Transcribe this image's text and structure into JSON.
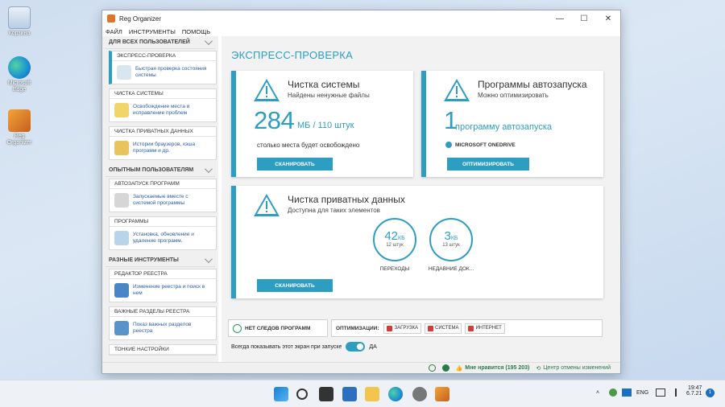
{
  "desktop": {
    "recycle_label": "Корзина",
    "edge_label": "Microsoft Edge",
    "reg_label": "Reg Organizer"
  },
  "window": {
    "title": "Reg Organizer",
    "min": "—",
    "max": "☐",
    "close": "✕"
  },
  "menu": [
    "ФАЙЛ",
    "ИНСТРУМЕНТЫ",
    "ПОМОЩЬ"
  ],
  "sidebar": {
    "sec1": "ДЛЯ ВСЕХ ПОЛЬЗОВАТЕЛЕЙ",
    "sec2": "ОПЫТНЫМ ПОЛЬЗОВАТЕЛЯМ",
    "sec3": "РАЗНЫЕ ИНСТРУМЕНТЫ",
    "items": [
      {
        "head": "ЭКСПРЕСС-ПРОВЕРКА",
        "text": "Быстрая проверка состояния системы"
      },
      {
        "head": "ЧИСТКА СИСТЕМЫ",
        "text": "Освобождение места и исправление проблем"
      },
      {
        "head": "ЧИСТКА ПРИВАТНЫХ ДАННЫХ",
        "text": "Истории браузеров, кэша программ и др."
      },
      {
        "head": "АВТОЗАПУСК ПРОГРАММ",
        "text": "Запускаемые вместе с системой программы"
      },
      {
        "head": "ПРОГРАММЫ",
        "text": "Установка, обновление и удаление программ."
      },
      {
        "head": "РЕДАКТОР РЕЕСТРА",
        "text": "Изменение реестра и поиск в нем"
      },
      {
        "head": "ВАЖНЫЕ РАЗДЕЛЫ РЕЕСТРА",
        "text": "Показ важных разделов реестра"
      },
      {
        "head": "ТОНКИЕ НАСТРОЙКИ",
        "text": ""
      }
    ]
  },
  "main": {
    "title": "ЭКСПРЕСС-ПРОВЕРКА",
    "clean": {
      "title": "Чистка системы",
      "sub": "Найдены ненужные файлы",
      "big": "284",
      "unit": "МБ / 110 штук",
      "note": "столько места будет освобождено",
      "button": "СКАНИРОВАТЬ"
    },
    "autorun": {
      "title": "Программы автозапуска",
      "sub": "Можно оптимизировать",
      "big": "1",
      "unit": "программу автозапуска",
      "item": "MICROSOFT ONEDRIVE",
      "button": "ОПТИМИЗИРОВАТЬ"
    },
    "private": {
      "title": "Чистка приватных данных",
      "sub": "Доступна для таких элементов",
      "button": "СКАНИРОВАТЬ",
      "rings": [
        {
          "value": "42",
          "unit": "КБ",
          "count": "12 штук",
          "label": "ПЕРЕХОДЫ"
        },
        {
          "value": "3",
          "unit": "КБ",
          "count": "13 штук",
          "label": "НЕДАВНИЕ ДОК..."
        }
      ]
    },
    "no_traces": "НЕТ СЛЕДОВ ПРОГРАММ",
    "optim_label": "ОПТИМИЗАЦИИ:",
    "optim_tags": [
      "ЗАГРУЗКА",
      "СИСТЕМА",
      "ИНТЕРНЕТ"
    ],
    "show_label": "Всегда показывать этот экран при запуске",
    "toggle_label": "ДА"
  },
  "status": {
    "like": "Мне нравится (195 203)",
    "undo": "Центр отмены изменений"
  },
  "tray": {
    "lang": "ENG",
    "time": "19:47",
    "date": "6.7.21",
    "badge": "1"
  },
  "colors": {
    "accent": "#2d9ec2"
  }
}
